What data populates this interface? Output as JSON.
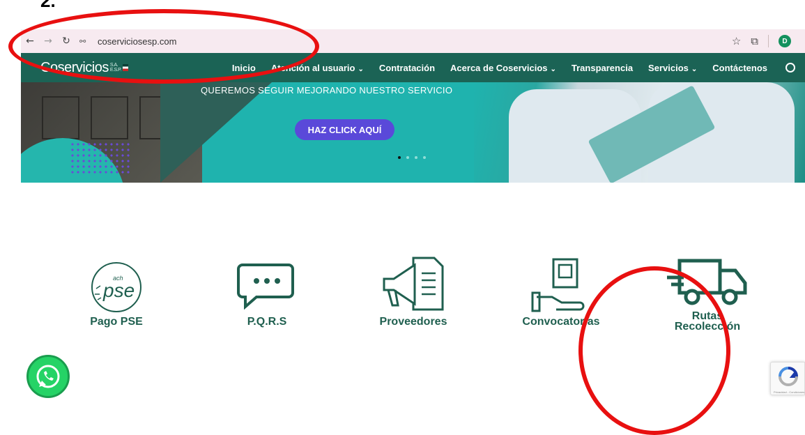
{
  "step_number": "2.",
  "browser": {
    "url": "coserviciosesp.com",
    "profile_initial": "D"
  },
  "site": {
    "logo_text": "Coservicios",
    "logo_sub_top": "S.A.",
    "logo_sub_bottom": "E.S.P.",
    "nav": [
      {
        "label": "Inicio",
        "has_dropdown": false
      },
      {
        "label": "Atención al usuario",
        "has_dropdown": true
      },
      {
        "label": "Contratación",
        "has_dropdown": false
      },
      {
        "label": "Acerca de Coservicios",
        "has_dropdown": true
      },
      {
        "label": "Transparencia",
        "has_dropdown": false
      },
      {
        "label": "Servicios",
        "has_dropdown": true
      },
      {
        "label": "Contáctenos",
        "has_dropdown": false
      }
    ]
  },
  "hero": {
    "headline": "QUEREMOS SEGUIR MEJORANDO NUESTRO SERVICIO",
    "button_label": "HAZ CLICK AQUÍ",
    "slide_count": 4,
    "active_slide": 1
  },
  "services": [
    {
      "label": "Pago PSE",
      "icon": "pse-icon",
      "icon_text_top": "ach",
      "icon_text_main": "pse"
    },
    {
      "label": "P.Q.R.S",
      "icon": "chat-bubble-icon"
    },
    {
      "label": "Proveedores",
      "icon": "megaphone-icon"
    },
    {
      "label": "Convocatorias",
      "icon": "hand-document-icon"
    },
    {
      "label": "Rutas Recolección",
      "label_line1": "Rutas",
      "label_line2": "Recolección",
      "icon": "truck-icon"
    }
  ],
  "recaptcha": {
    "footer_text": "Privacidad - Condiciones"
  },
  "colors": {
    "brand_dark_green": "#1b6355",
    "hero_teal": "#1fb3ae",
    "button_purple": "#5a49d9",
    "annotation_red": "#e81010",
    "whatsapp_green": "#25d366"
  }
}
